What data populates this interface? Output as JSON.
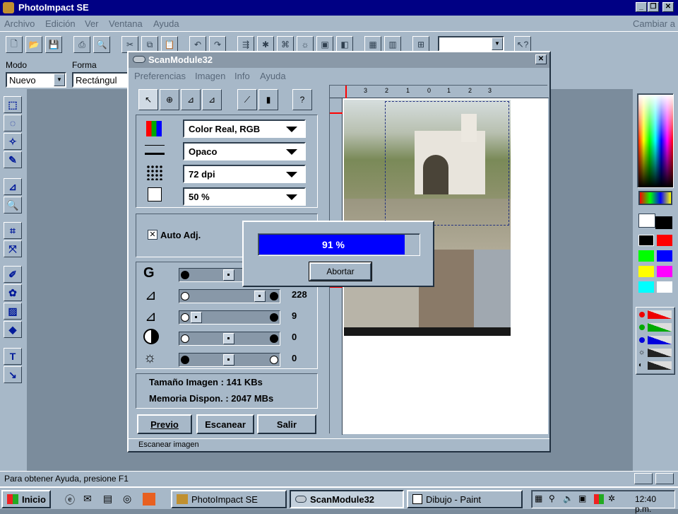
{
  "app": {
    "title": "PhotoImpact SE",
    "switch_link": "Cambiar a"
  },
  "menu": [
    "Archivo",
    "Edición",
    "Ver",
    "Ventana",
    "Ayuda"
  ],
  "attrbar": {
    "mode_label": "Modo",
    "mode_value": "Nuevo",
    "shape_label": "Forma",
    "shape_value": "Rectángul"
  },
  "scan": {
    "title": "ScanModule32",
    "menu": [
      "Preferencias",
      "Imagen",
      "Info",
      "Ayuda"
    ],
    "dropdowns": {
      "color": "Color Real, RGB",
      "material": "Opaco",
      "resolution": "72 dpi",
      "scale": "50 %"
    },
    "auto_adj": "Auto Adj.",
    "sliders": [
      {
        "name": "gamma",
        "label": "G",
        "value": ""
      },
      {
        "name": "highlight",
        "label": "",
        "value": "228"
      },
      {
        "name": "shadow",
        "label": "",
        "value": "9"
      },
      {
        "name": "contrast",
        "label": "",
        "value": "0"
      },
      {
        "name": "brightness",
        "label": "",
        "value": "0"
      }
    ],
    "image_size": "Tamaño Imagen : 141 KBs",
    "memory": "Memoria Dispon. : 2047 MBs",
    "buttons": {
      "preview": "Previo",
      "scan": "Escanear",
      "exit": "Salir"
    },
    "status": "Escanear imagen",
    "ruler_ticks": [
      "3",
      "2",
      "1",
      "0",
      "1",
      "2",
      "3"
    ]
  },
  "progress": {
    "percent_text": "91 %",
    "value": 0.91,
    "abort": "Abortar"
  },
  "statusbar": {
    "help": "Para obtener Ayuda, presione F1"
  },
  "taskbar": {
    "start": "Inicio",
    "tasks": [
      "PhotoImpact SE",
      "ScanModule32",
      "Dibujo - Paint"
    ],
    "clock": "12:40 p.m."
  },
  "colors": {
    "titlebar": "#000084",
    "progress": "#0000ff",
    "face": "#a7b8c8",
    "workspace": "#7b8c9c"
  }
}
